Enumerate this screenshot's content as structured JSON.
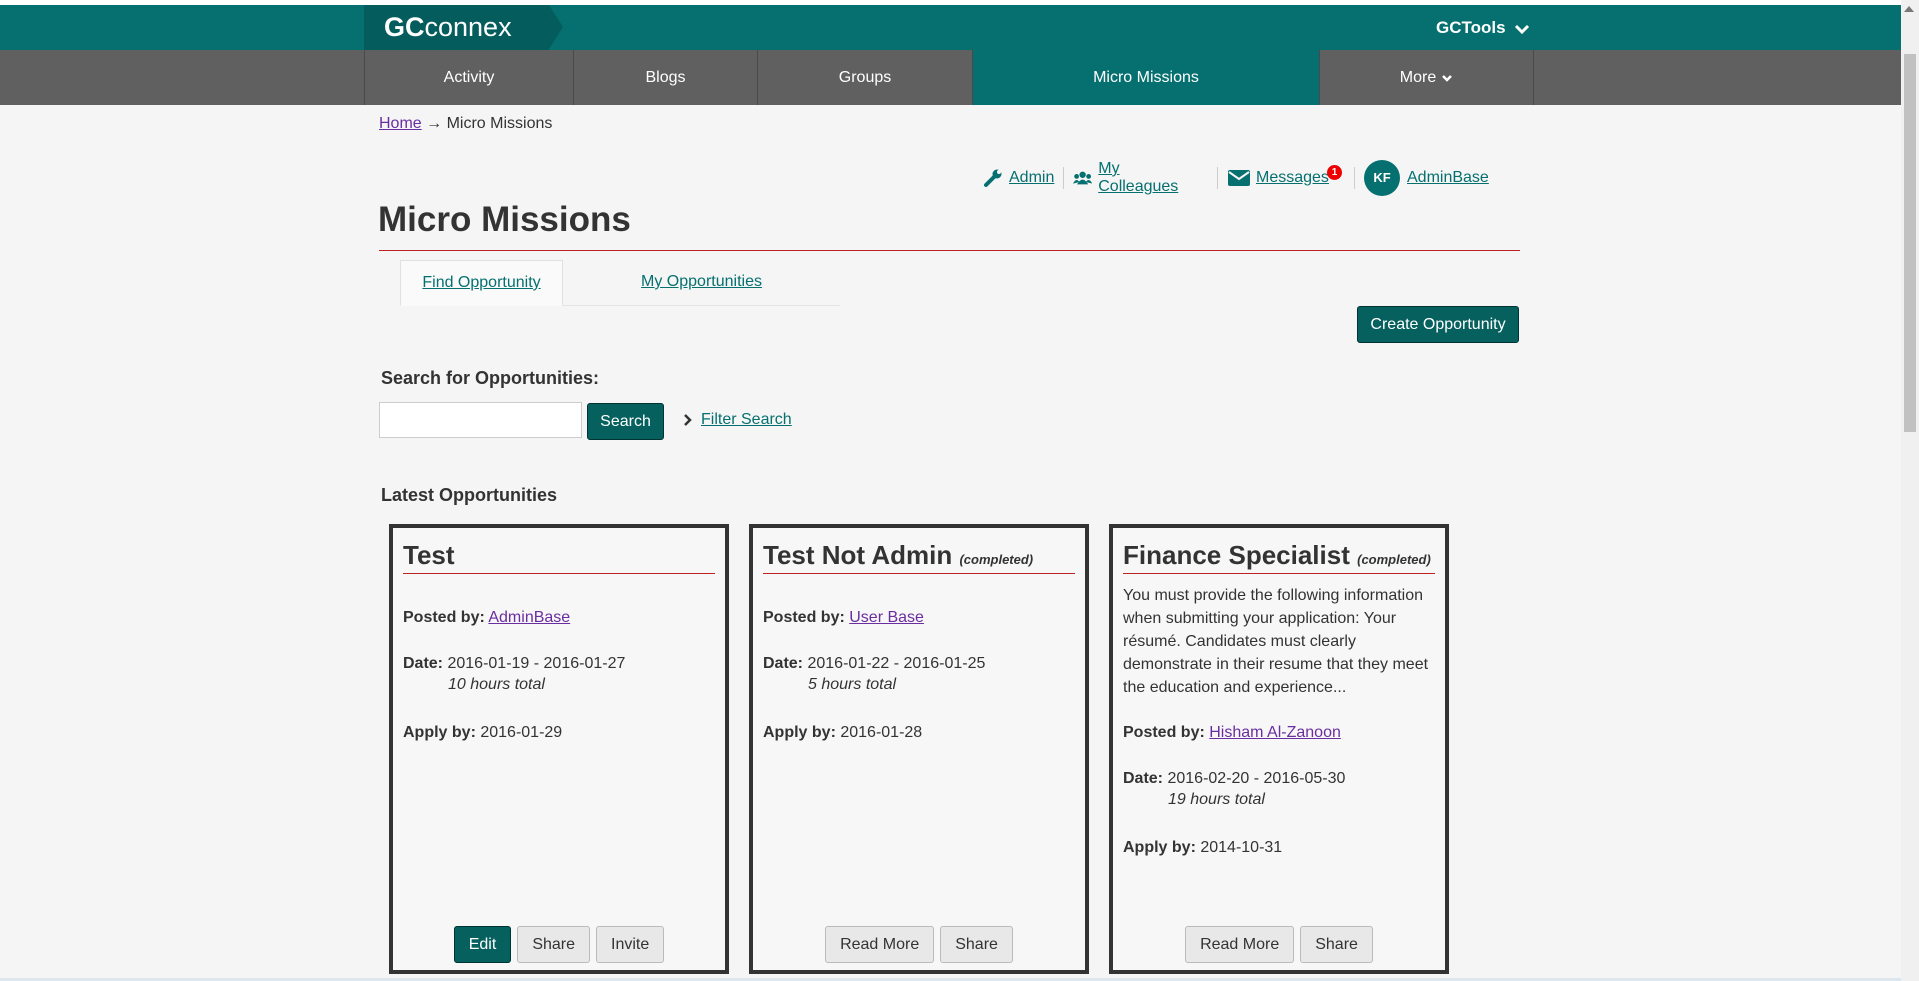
{
  "header": {
    "logo_gc": "GC",
    "logo_rest": "connex",
    "tools_label": "GCTools",
    "colors": {
      "primary": "#05706f",
      "dark": "#045d5c",
      "nav_bg": "#606060",
      "accent_rule": "#bb2222",
      "link_visited": "#6a2ea0"
    }
  },
  "nav": {
    "items": [
      "Activity",
      "Blogs",
      "Groups",
      "Micro Missions",
      "More"
    ],
    "active": "Micro Missions"
  },
  "breadcrumb": {
    "home": "Home",
    "arrow": "→",
    "current": "Micro Missions"
  },
  "user_menu": {
    "admin": "Admin",
    "colleagues": "My Colleagues",
    "messages": "Messages",
    "messages_count": "1",
    "avatar_initials": "KF",
    "username": "AdminBase"
  },
  "page": {
    "title": "Micro Missions",
    "tabs": [
      "Find Opportunity",
      "My Opportunities"
    ],
    "active_tab": "Find Opportunity",
    "create_button": "Create Opportunity",
    "search_label": "Search for Opportunities:",
    "search_value": "",
    "search_button": "Search",
    "filter_link": "Filter Search",
    "latest_label": "Latest Opportunities"
  },
  "labels": {
    "posted_by": "Posted by:",
    "date": "Date:",
    "apply_by": "Apply by:"
  },
  "cards": [
    {
      "title": "Test",
      "status": "",
      "description": "",
      "posted_by": "AdminBase",
      "date": "2016-01-19 - 2016-01-27",
      "hours": "10 hours total",
      "apply_by": "2016-01-29",
      "buttons": [
        "Edit",
        "Share",
        "Invite"
      ]
    },
    {
      "title": "Test Not Admin",
      "status": "(completed)",
      "description": "",
      "posted_by": "User Base",
      "date": "2016-01-22 - 2016-01-25",
      "hours": "5 hours total",
      "apply_by": "2016-01-28",
      "buttons": [
        "Read More",
        "Share"
      ]
    },
    {
      "title": "Finance Specialist",
      "status": "(completed)",
      "description": "You must provide the following information when submitting your application: Your résumé. Candidates must clearly demonstrate in their resume that they meet the education and experience...",
      "posted_by": "Hisham Al-Zanoon",
      "date": "2016-02-20 - 2016-05-30",
      "hours": "19 hours total",
      "apply_by": "2014-10-31",
      "buttons": [
        "Read More",
        "Share"
      ]
    }
  ]
}
